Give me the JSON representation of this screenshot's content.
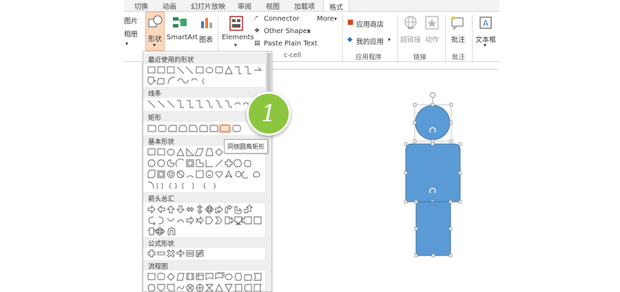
{
  "tabs": [
    "切换",
    "动画",
    "幻灯片放映",
    "审阅",
    "视图",
    "加载项",
    "格式"
  ],
  "active_tab_index": 6,
  "ribbon": {
    "partial_top": "图片",
    "partial_mid": "相册",
    "shapes_label": "形状",
    "smartart_label": "SmartArt",
    "chart_label": "图表",
    "elements_label": "Elements",
    "connector_label": "Connector",
    "other_shapes_label": "Other Shapes",
    "more_label": "More",
    "paste_plain_label": "Paste Plain Text",
    "group_cell_partial": "c-cell",
    "app_store_label": "应用商店",
    "my_apps_label": "我的应用",
    "apps_group_label": "应用程序",
    "hyperlink_label": "超链接",
    "action_label": "动作",
    "links_group_label": "链接",
    "comment_label": "批注",
    "comments_group_label": "批注",
    "textbox_label": "文本框"
  },
  "gallery": {
    "sections": [
      "最近使用的形状",
      "线条",
      "矩形",
      "基本形状",
      "箭头总汇",
      "公式形状",
      "流程图"
    ]
  },
  "tooltip_text": "同侧圆角矩形",
  "step_badge": "1",
  "colors": {
    "shape_fill": "#5b9bd5",
    "shape_stroke": "#41719c",
    "badge_green": "#8cc63f",
    "accent_orange": "#d24726"
  }
}
